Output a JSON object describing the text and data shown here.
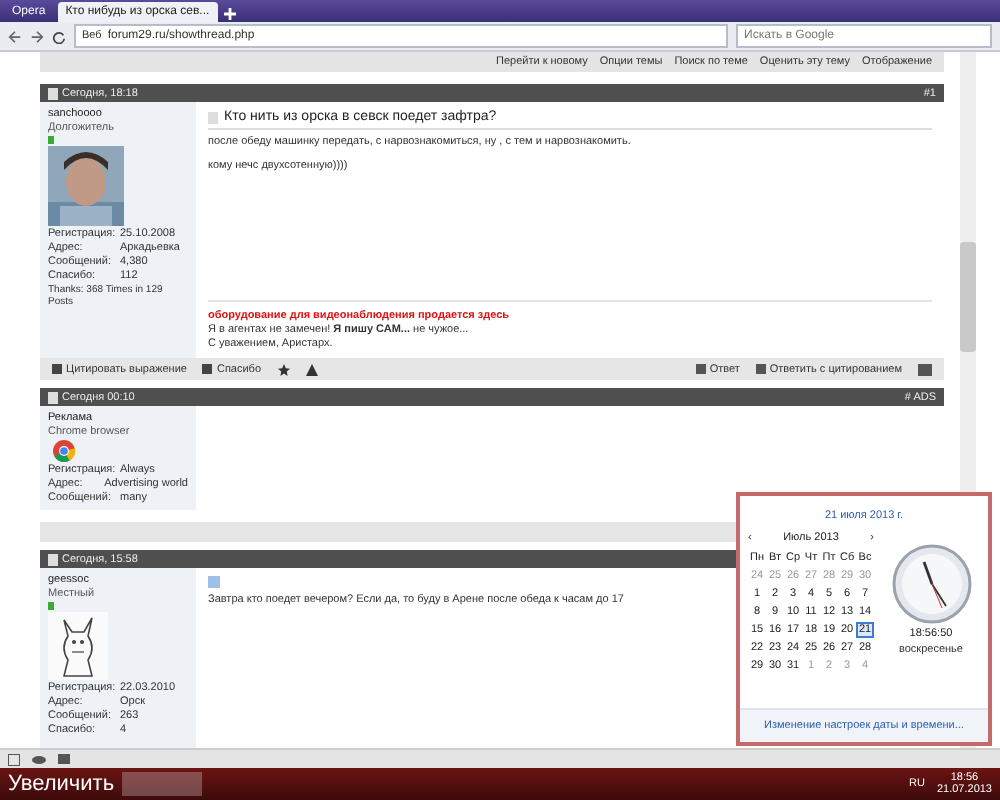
{
  "browser": {
    "tabs": [
      {
        "label": "Opera",
        "selected": false
      },
      {
        "label": "Кто нибудь из орска сев...",
        "selected": true
      }
    ],
    "site_label": "Веб",
    "address": "forum29.ru/showthread.php",
    "search": {
      "placeholder": "Искать в Google"
    }
  },
  "thread_tools": [
    "Перейти к новому",
    "Опции темы",
    "Поиск по теме",
    "Оценить эту тему",
    "Отображение"
  ],
  "posts": [
    {
      "date": "Сегодня, 18:18",
      "number": "#1",
      "user": "sanchoooo",
      "rank": "Долгожитель",
      "online": true,
      "kind": "member",
      "stats": [
        {
          "label": "Регистрация:",
          "value": "25.10.2008"
        },
        {
          "label": "Адрес:",
          "value": "Аркадьевка"
        },
        {
          "label": "Сообщений:",
          "value": "4,380"
        },
        {
          "label": "Спасибо:",
          "value": "112"
        }
      ],
      "extra": "Thanks: 368 Times in 129 Posts",
      "title": "Кто нить из орска в севск поедет зафтра?",
      "body": [
        "после обеду машинку передать, с нарвознакомиться, ну , с тем и нарвознакомить.",
        "кому нечс двухсотенную))))"
      ],
      "signature": [
        {
          "text": "оборудование для видеонаблюдения продается здесь",
          "kind": "ad"
        },
        {
          "text": "Я в агентах не замечен! **Я пишу САМ...** не чужое...",
          "kind": "plain"
        },
        {
          "text": "С уважением, Аристарх.",
          "kind": "plain"
        }
      ],
      "actions_left": [
        "Цитировать выражение",
        "Спасибо"
      ],
      "actions_right": [
        "Ответ",
        "Ответить с цитированием"
      ]
    },
    {
      "date": "Сегодня 00:10",
      "number": "# ADS",
      "user": "Реклама",
      "rank": "Chrome browser",
      "online": false,
      "kind": "ad",
      "stats": [
        {
          "label": "Регистрация:",
          "value": "Always"
        },
        {
          "label": "Адрес:",
          "value": "Advertising world"
        },
        {
          "label": "Сообщений:",
          "value": "many"
        }
      ]
    },
    {
      "date": "Сегодня, 15:58",
      "user": "geessoc",
      "rank": "Местный",
      "online": true,
      "kind": "member",
      "stats": [
        {
          "label": "Регистрация:",
          "value": "22.03.2010"
        },
        {
          "label": "Адрес:",
          "value": "Орск"
        },
        {
          "label": "Сообщений:",
          "value": "263"
        },
        {
          "label": "Спасибо:",
          "value": "4"
        }
      ],
      "body": [
        "Завтра кто поедет вечером? Если да, то буду в Арене после обеда к часам до 17"
      ]
    }
  ],
  "calendar": {
    "date_link": "21 июля 2013 г.",
    "prev": "‹",
    "month": "Июль 2013",
    "next": "›",
    "weekdays": [
      "Пн",
      "Вт",
      "Ср",
      "Чт",
      "Пт",
      "Сб",
      "Вс"
    ],
    "weeks": [
      [
        {
          "day": "24",
          "muted": true,
          "selected": false
        },
        {
          "day": "25",
          "muted": true,
          "selected": false
        },
        {
          "day": "26",
          "muted": true,
          "selected": false
        },
        {
          "day": "27",
          "muted": true,
          "selected": false
        },
        {
          "day": "28",
          "muted": true,
          "selected": false
        },
        {
          "day": "29",
          "muted": true,
          "selected": false
        },
        {
          "day": "30",
          "muted": true,
          "selected": false
        }
      ],
      [
        {
          "day": "1",
          "muted": false,
          "selected": false
        },
        {
          "day": "2",
          "muted": false,
          "selected": false
        },
        {
          "day": "3",
          "muted": false,
          "selected": false
        },
        {
          "day": "4",
          "muted": false,
          "selected": false
        },
        {
          "day": "5",
          "muted": false,
          "selected": false
        },
        {
          "day": "6",
          "muted": false,
          "selected": false
        },
        {
          "day": "7",
          "muted": false,
          "selected": false
        }
      ],
      [
        {
          "day": "8",
          "muted": false,
          "selected": false
        },
        {
          "day": "9",
          "muted": false,
          "selected": false
        },
        {
          "day": "10",
          "muted": false,
          "selected": false
        },
        {
          "day": "11",
          "muted": false,
          "selected": false
        },
        {
          "day": "12",
          "muted": false,
          "selected": false
        },
        {
          "day": "13",
          "muted": false,
          "selected": false
        },
        {
          "day": "14",
          "muted": false,
          "selected": false
        }
      ],
      [
        {
          "day": "15",
          "muted": false,
          "selected": false
        },
        {
          "day": "16",
          "muted": false,
          "selected": false
        },
        {
          "day": "17",
          "muted": false,
          "selected": false
        },
        {
          "day": "18",
          "muted": false,
          "selected": false
        },
        {
          "day": "19",
          "muted": false,
          "selected": false
        },
        {
          "day": "20",
          "muted": false,
          "selected": false
        },
        {
          "day": "21",
          "muted": false,
          "selected": true
        }
      ],
      [
        {
          "day": "22",
          "muted": false,
          "selected": false
        },
        {
          "day": "23",
          "muted": false,
          "selected": false
        },
        {
          "day": "24",
          "muted": false,
          "selected": false
        },
        {
          "day": "25",
          "muted": false,
          "selected": false
        },
        {
          "day": "26",
          "muted": false,
          "selected": false
        },
        {
          "day": "27",
          "muted": false,
          "selected": false
        },
        {
          "day": "28",
          "muted": false,
          "selected": false
        }
      ],
      [
        {
          "day": "29",
          "muted": false,
          "selected": false
        },
        {
          "day": "30",
          "muted": false,
          "selected": false
        },
        {
          "day": "31",
          "muted": false,
          "selected": false
        },
        {
          "day": "1",
          "muted": true,
          "selected": false
        },
        {
          "day": "2",
          "muted": true,
          "selected": false
        },
        {
          "day": "3",
          "muted": true,
          "selected": false
        },
        {
          "day": "4",
          "muted": true,
          "selected": false
        }
      ]
    ],
    "time": "18:56:50",
    "weekday": "воскресенье",
    "settings_link": "Изменение настроек даты и времени..."
  },
  "taskbar": {
    "tooltip": "Увеличить",
    "language": "RU",
    "time": "18:56",
    "date": "21.07.2013"
  }
}
